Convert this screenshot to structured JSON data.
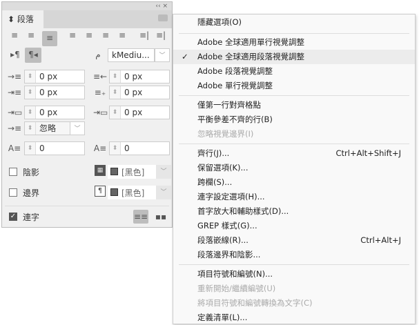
{
  "panel": {
    "title": "段落",
    "top_controls": "‹‹  ×",
    "fields": {
      "left_indent": "0 px",
      "right_indent": "0 px",
      "first_line_indent": "0 px",
      "last_line_indent": "0 px",
      "space_before": "0 px",
      "space_after": "0 px",
      "drop_cap_lines": "0",
      "drop_cap_chars": "0"
    },
    "align_to_grid": "忽略",
    "composer": "kMediu...",
    "shading": {
      "label": "陰影",
      "checked": false,
      "color": "[黑色]"
    },
    "border": {
      "label": "邊界",
      "checked": false,
      "color": "[黑色]"
    },
    "hyphenate": {
      "label": "連字",
      "checked": true
    }
  },
  "menu": {
    "items": [
      {
        "label": "隱藏選項(O)"
      },
      {
        "label": "Adobe 全球適用單行視覺調整"
      },
      {
        "label": "Adobe 全球適用段落視覺調整",
        "checked": true
      },
      {
        "label": "Adobe 段落視覺調整"
      },
      {
        "label": "Adobe 單行視覺調整"
      },
      {
        "label": "僅第一行對齊格點"
      },
      {
        "label": "平衡參差不齊的行(B)"
      },
      {
        "label": "忽略視覺邊界(I)",
        "disabled": true
      },
      {
        "label": "齊行(J)...",
        "shortcut": "Ctrl+Alt+Shift+J"
      },
      {
        "label": "保留選項(K)..."
      },
      {
        "label": "跨欄(S)..."
      },
      {
        "label": "連字設定選項(H)..."
      },
      {
        "label": "首字放大和輔助樣式(D)..."
      },
      {
        "label": "GREP 樣式(G)..."
      },
      {
        "label": "段落嵌線(R)...",
        "shortcut": "Ctrl+Alt+J"
      },
      {
        "label": "段落邊界和陰影..."
      },
      {
        "label": "項目符號和編號(N)..."
      },
      {
        "label": "重新開始/繼續編號(U)",
        "disabled": true
      },
      {
        "label": "將項目符號和編號轉換為文字(C)",
        "disabled": true
      },
      {
        "label": "定義清單(L)..."
      }
    ],
    "check_glyph": "✓"
  }
}
